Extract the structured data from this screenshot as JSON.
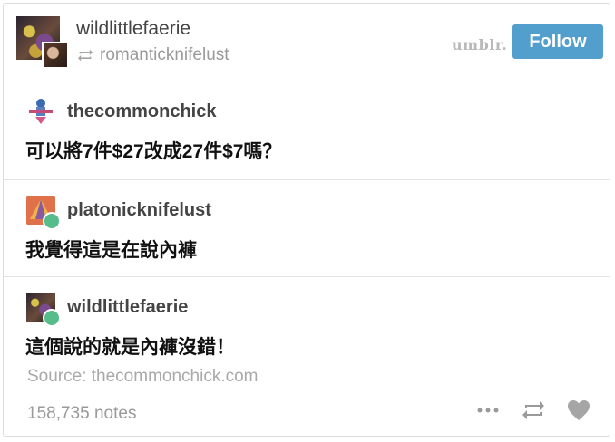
{
  "header": {
    "blog_name": "wildlittlefaerie",
    "reblogged_from": "romanticknifelust",
    "brand_partial": "umblr.",
    "follow_label": "Follow"
  },
  "entries": [
    {
      "username": "thecommonchick",
      "text": "可以將7件$27改成27件$7嗎？"
    },
    {
      "username": "platonicknifelust",
      "text": "我覺得這是在說內褲"
    },
    {
      "username": "wildlittlefaerie",
      "text": "這個說的就是內褲沒錯！"
    }
  ],
  "footer": {
    "source": "Source: thecommonchick.com",
    "notes": "158,735 notes"
  },
  "colors": {
    "follow": "#529ecc",
    "online_dot": "#56bc8a"
  },
  "icons": [
    "reblog-icon",
    "more-icon",
    "like-icon"
  ]
}
